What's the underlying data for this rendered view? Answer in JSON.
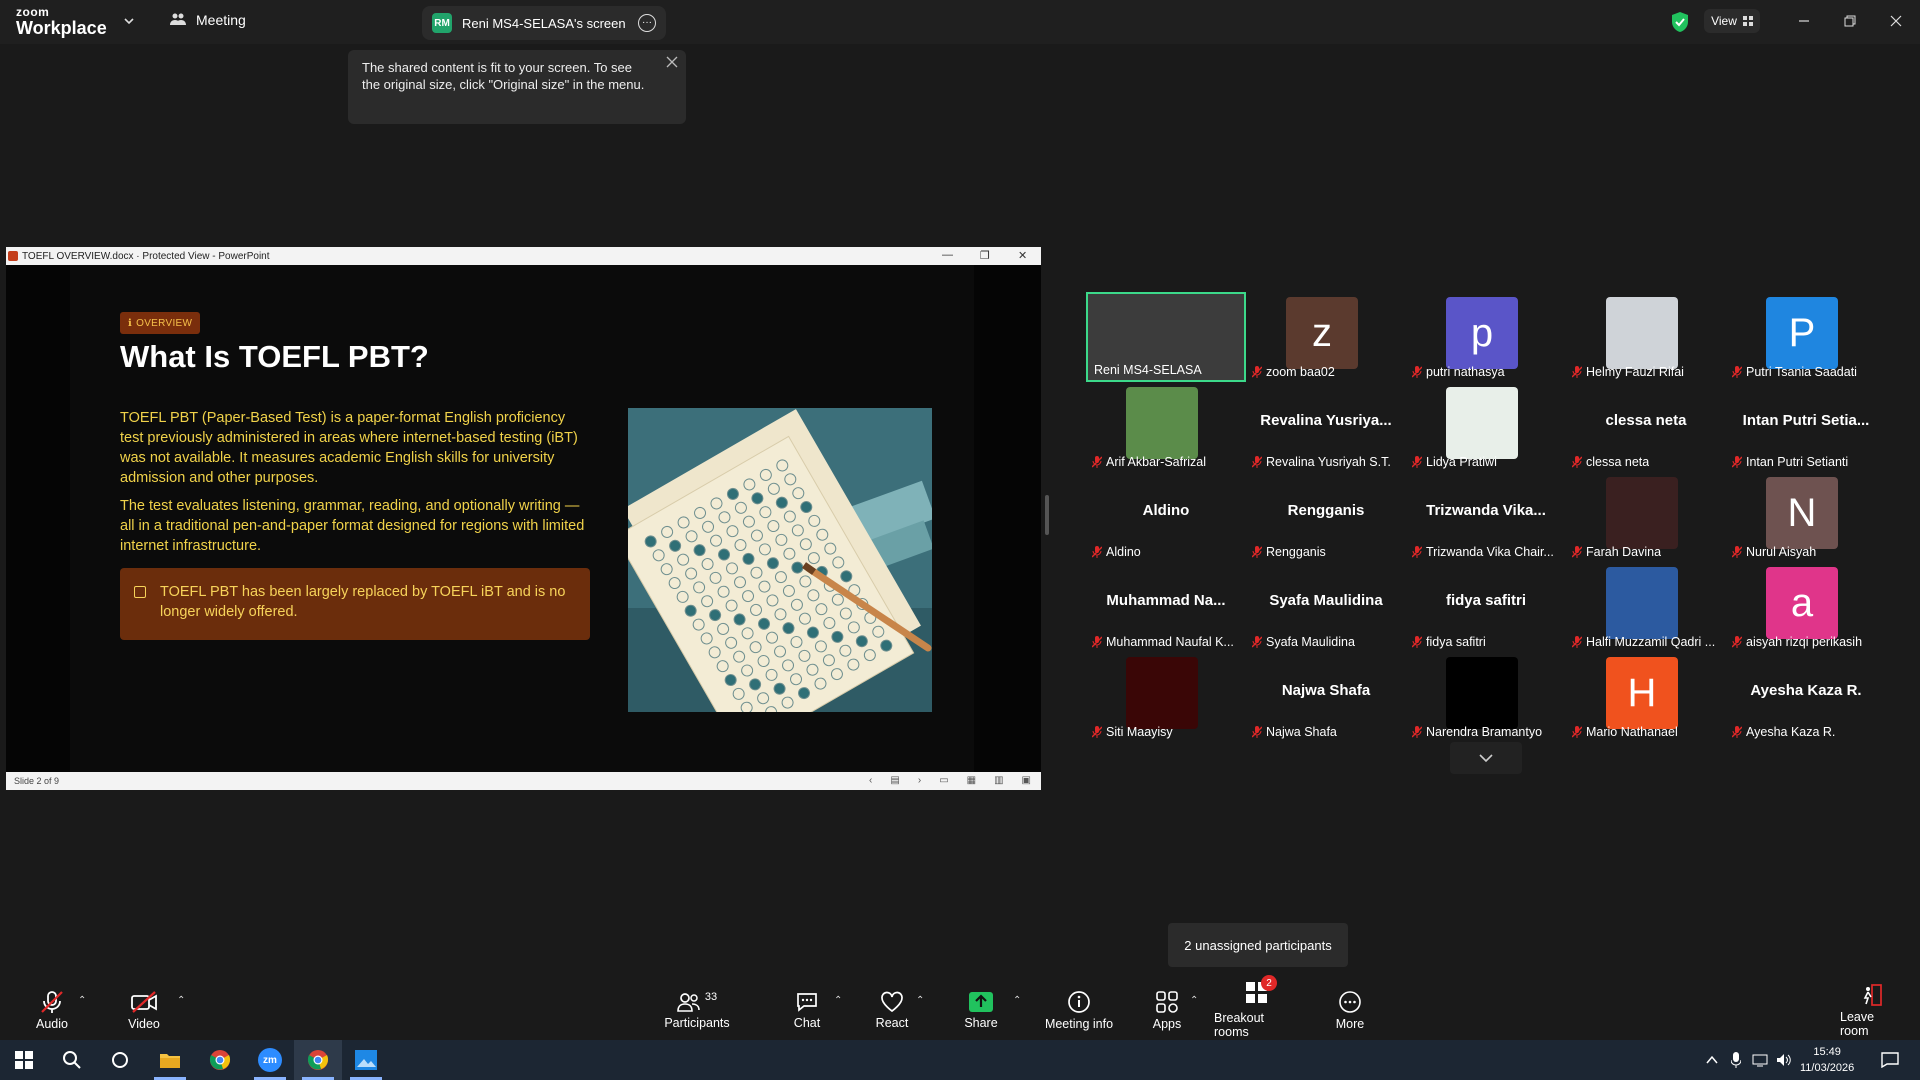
{
  "app": {
    "logo_line1": "zoom",
    "logo_line2": "Workplace",
    "meeting_label": "Meeting",
    "screen_tab": "Reni MS4-SELASA's screen",
    "screen_tab_initials": "RM",
    "view_label": "View"
  },
  "tooltip": {
    "text": "The shared content is fit to your screen. To see the original size, click \"Original size\" in the menu."
  },
  "ppt": {
    "window_title": "TOEFL OVERVIEW.docx  ·  Protected View - PowerPoint",
    "status": "Slide 2 of 9",
    "badge": "OVERVIEW",
    "title": "What Is TOEFL PBT?",
    "para1": "TOEFL PBT (Paper-Based Test) is a paper-format English proficiency test previously administered in areas where internet-based testing (iBT) was not available. It measures academic English skills for university admission and other purposes.",
    "para2": "The test evaluates listening, grammar, reading, and optionally writing — all in a traditional pen-and-paper format designed for regions with limited internet infrastructure.",
    "callout": "TOEFL PBT has been largely replaced by TOEFL iBT and is no longer widely offered."
  },
  "participants": [
    {
      "name": "Reni MS4-SELASA",
      "big": "",
      "letter": "",
      "color": "#5a5a5a",
      "muted": false,
      "kind": "video"
    },
    {
      "name": "zoom baa02",
      "big": "",
      "letter": "z",
      "color": "#5b3a2e",
      "muted": true,
      "kind": "letter"
    },
    {
      "name": "putri nathasya",
      "big": "",
      "letter": "p",
      "color": "#5a55c8",
      "muted": true,
      "kind": "letter"
    },
    {
      "name": "Helmy Fauzi Rifai",
      "big": "",
      "letter": "",
      "color": "#cfd3d8",
      "muted": true,
      "kind": "photo"
    },
    {
      "name": "Putri Tsania Saadati",
      "big": "",
      "letter": "P",
      "color": "#1f86e0",
      "muted": true,
      "kind": "letter"
    },
    {
      "name": "Arif Akbar-Safrizal",
      "big": "",
      "letter": "",
      "color": "#5b8c4a",
      "muted": true,
      "kind": "photo"
    },
    {
      "name": "Revalina Yusriyah S.T.",
      "big": "Revalina  Yusriya...",
      "letter": "",
      "color": "",
      "muted": true,
      "kind": "text"
    },
    {
      "name": "Lidya Pratiwi",
      "big": "",
      "letter": "",
      "color": "#e8efe9",
      "muted": true,
      "kind": "photo"
    },
    {
      "name": "clessa neta",
      "big": "clessa neta",
      "letter": "",
      "color": "",
      "muted": true,
      "kind": "text"
    },
    {
      "name": "Intan Putri Setianti",
      "big": "Intan  Putri  Setia...",
      "letter": "",
      "color": "",
      "muted": true,
      "kind": "text"
    },
    {
      "name": "Aldino",
      "big": "Aldino",
      "letter": "",
      "color": "",
      "muted": true,
      "kind": "text"
    },
    {
      "name": "Rengganis",
      "big": "Rengganis",
      "letter": "",
      "color": "",
      "muted": true,
      "kind": "text"
    },
    {
      "name": "Trizwanda Vika Chair...",
      "big": "Trizwanda  Vika...",
      "letter": "",
      "color": "",
      "muted": true,
      "kind": "text"
    },
    {
      "name": "Farah Davina",
      "big": "",
      "letter": "",
      "color": "#3a2020",
      "muted": true,
      "kind": "photo"
    },
    {
      "name": "Nurul Aisyah",
      "big": "",
      "letter": "N",
      "color": "#6e5250",
      "muted": true,
      "kind": "letter"
    },
    {
      "name": "Muhammad Naufal K...",
      "big": "Muhammad  Na...",
      "letter": "",
      "color": "",
      "muted": true,
      "kind": "text"
    },
    {
      "name": "Syafa Maulidina",
      "big": "Syafa Maulidina",
      "letter": "",
      "color": "",
      "muted": true,
      "kind": "text"
    },
    {
      "name": "fidya safitri",
      "big": "fidya safitri",
      "letter": "",
      "color": "",
      "muted": true,
      "kind": "text"
    },
    {
      "name": "Halfi Muzzamil Qadri ...",
      "big": "",
      "letter": "",
      "color": "#2c5aa0",
      "muted": true,
      "kind": "photo"
    },
    {
      "name": "aisyah rizqi perikasih",
      "big": "",
      "letter": "a",
      "color": "#e0358a",
      "muted": true,
      "kind": "letter"
    },
    {
      "name": "Siti Maayisy",
      "big": "",
      "letter": "",
      "color": "#3a0606",
      "muted": true,
      "kind": "photo"
    },
    {
      "name": "Najwa Shafa",
      "big": "Najwa Shafa",
      "letter": "",
      "color": "",
      "muted": true,
      "kind": "text"
    },
    {
      "name": "Narendra Bramantyo",
      "big": "",
      "letter": "",
      "color": "#000000",
      "muted": true,
      "kind": "photo"
    },
    {
      "name": "Mario Nathanael",
      "big": "",
      "letter": "H",
      "color": "#f0521e",
      "muted": true,
      "kind": "letter"
    },
    {
      "name": "Ayesha Kaza R.",
      "big": "Ayesha Kaza R.",
      "letter": "",
      "color": "",
      "muted": true,
      "kind": "text"
    }
  ],
  "unassigned": "2 unassigned participants",
  "toolbar": {
    "audio": "Audio",
    "video": "Video",
    "participants": "Participants",
    "participants_count": "33",
    "chat": "Chat",
    "react": "React",
    "share": "Share",
    "meeting_info": "Meeting info",
    "apps": "Apps",
    "breakout": "Breakout rooms",
    "breakout_badge": "2",
    "more": "More",
    "leave": "Leave room"
  },
  "taskbar": {
    "time": "15:49",
    "date": "11/03/2026",
    "zm_label": "zm"
  },
  "colors": {
    "accent_green": "#3cd98a",
    "share_green": "#21c25e",
    "muted_red": "#e02828"
  }
}
